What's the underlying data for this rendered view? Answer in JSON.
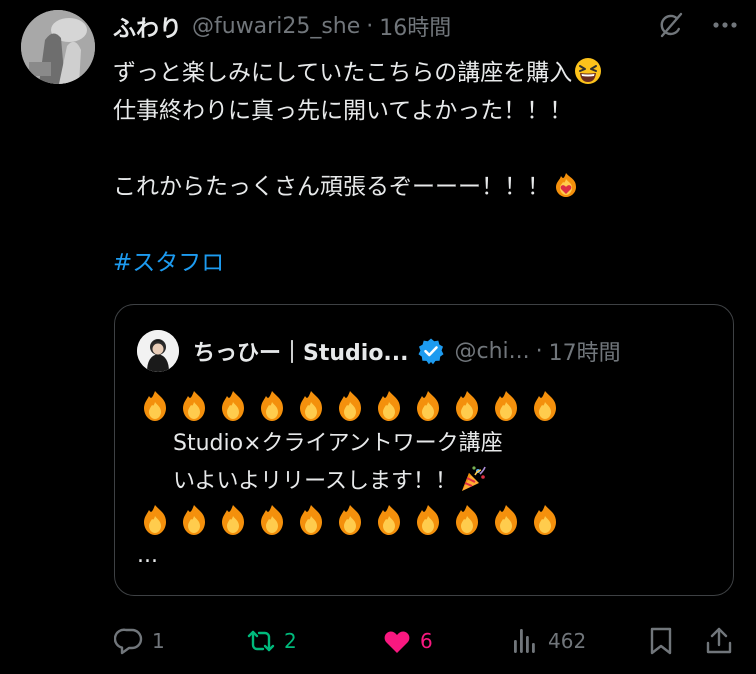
{
  "author": {
    "display_name": "ふわり",
    "handle": "@fuwari25_she",
    "separator": "·",
    "time": "16時間"
  },
  "header_icons": {
    "grok": "grok-icon",
    "more": "more-icon"
  },
  "tweet": {
    "line1": "ずっと楽しみにしていたこちらの講座を購入",
    "line2": "仕事終わりに真っ先に開いてよかった！！！",
    "line3": "これからたっくさん頑張るぞーーー！！！",
    "hashtag": "#スタフロ",
    "emoji1": "grinning-squinting-face",
    "emoji2": "heart-on-fire"
  },
  "quote": {
    "display_name": "ちっひー｜Studio...",
    "handle": "@chi...",
    "separator": "·",
    "time": "17時間",
    "verified": "verified-badge",
    "fire_count": 11,
    "line1": "Studio×クライアントワーク講座",
    "line2": "いよいよリリースします！！",
    "line2_emoji": "party-popper",
    "ellipsis": "..."
  },
  "actions": {
    "replies": "1",
    "reposts": "2",
    "likes": "6",
    "views": "462"
  },
  "colors": {
    "background": "#000000",
    "text": "#e7e9ea",
    "muted": "#71767b",
    "link": "#1d9bf0",
    "repost": "#00ba7c",
    "like": "#f91880",
    "border": "#3e4144"
  }
}
